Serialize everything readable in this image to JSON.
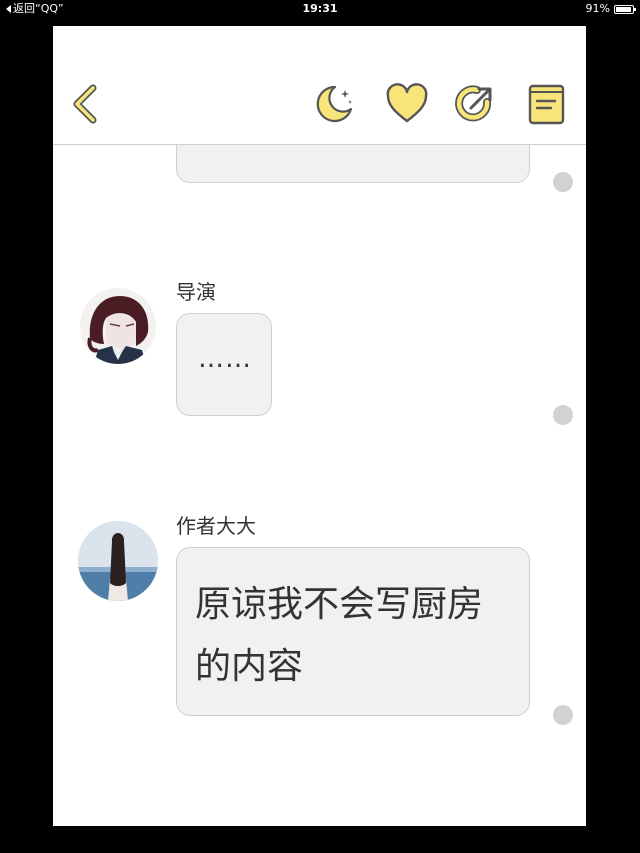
{
  "status_bar": {
    "back_label": "返回“QQ”",
    "time": "19:31",
    "battery_text": "91%",
    "battery_level": 0.91
  },
  "toolbar": {
    "icons": [
      "back-chevron-icon",
      "moon-icon",
      "heart-icon",
      "share-icon",
      "book-icon"
    ],
    "accent_color": "#f7e57a",
    "stroke_color": "#555555"
  },
  "messages": [
    {
      "sender": "",
      "text": ""
    },
    {
      "sender": "导演",
      "text": "……"
    },
    {
      "sender": "作者大大",
      "text_line1": "原谅我不会写厨房",
      "text_line2": "的内容"
    }
  ]
}
